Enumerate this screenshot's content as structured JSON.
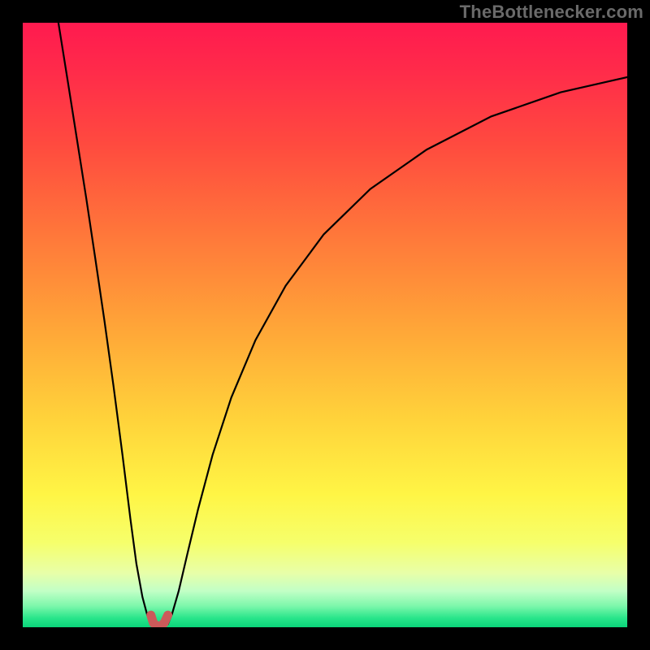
{
  "watermark": {
    "text": "TheBottlenecker.com"
  },
  "chart_data": {
    "type": "line",
    "title": "",
    "xlabel": "",
    "ylabel": "",
    "xlim": [
      0,
      1
    ],
    "ylim": [
      0,
      1
    ],
    "series": [
      {
        "name": "left-branch",
        "x": [
          0.059,
          0.075,
          0.09,
          0.105,
          0.12,
          0.135,
          0.15,
          0.165,
          0.178,
          0.188,
          0.198,
          0.206,
          0.213
        ],
        "y": [
          1.0,
          0.9,
          0.805,
          0.71,
          0.61,
          0.508,
          0.4,
          0.285,
          0.18,
          0.105,
          0.05,
          0.02,
          0.005
        ]
      },
      {
        "name": "right-branch",
        "x": [
          0.24,
          0.247,
          0.258,
          0.272,
          0.29,
          0.314,
          0.345,
          0.385,
          0.435,
          0.498,
          0.575,
          0.668,
          0.775,
          0.89,
          1.0
        ],
        "y": [
          0.005,
          0.022,
          0.06,
          0.12,
          0.195,
          0.285,
          0.38,
          0.475,
          0.565,
          0.65,
          0.725,
          0.79,
          0.845,
          0.885,
          0.91
        ]
      },
      {
        "name": "bottom-marker",
        "x": [
          0.212,
          0.216,
          0.222,
          0.228,
          0.234,
          0.24
        ],
        "y": [
          0.02,
          0.007,
          0.002,
          0.002,
          0.007,
          0.02
        ]
      }
    ],
    "background": {
      "gradient_stops": [
        {
          "offset": 0.0,
          "color": "#ff1a4f"
        },
        {
          "offset": 0.08,
          "color": "#ff2b4a"
        },
        {
          "offset": 0.2,
          "color": "#ff4a3f"
        },
        {
          "offset": 0.35,
          "color": "#ff773a"
        },
        {
          "offset": 0.5,
          "color": "#ffa438"
        },
        {
          "offset": 0.65,
          "color": "#ffd13a"
        },
        {
          "offset": 0.78,
          "color": "#fff545"
        },
        {
          "offset": 0.86,
          "color": "#f6ff6b"
        },
        {
          "offset": 0.91,
          "color": "#e8ffa8"
        },
        {
          "offset": 0.94,
          "color": "#c2ffc6"
        },
        {
          "offset": 0.965,
          "color": "#7cf7ab"
        },
        {
          "offset": 0.985,
          "color": "#28e58a"
        },
        {
          "offset": 1.0,
          "color": "#0ad47a"
        }
      ]
    },
    "curve_stroke": {
      "color": "#000000",
      "width": 2.2
    },
    "marker_stroke": {
      "color": "#cc5a5a",
      "width": 11,
      "linecap": "round"
    }
  }
}
